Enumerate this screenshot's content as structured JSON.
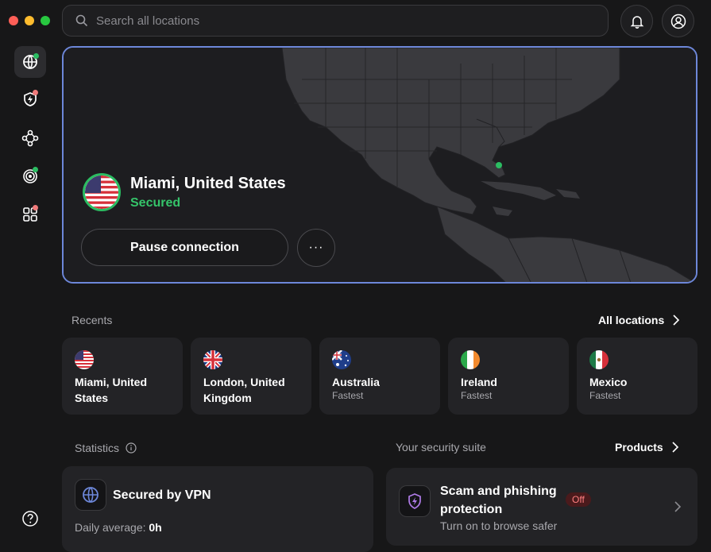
{
  "search": {
    "placeholder": "Search all locations"
  },
  "connection": {
    "location": "Miami, United States",
    "status": "Secured",
    "pause_label": "Pause connection",
    "more_label": "···"
  },
  "recents": {
    "label": "Recents",
    "all_label": "All locations",
    "items": [
      {
        "name": "Miami, United States",
        "sub": "",
        "flag": "us"
      },
      {
        "name": "London, United Kingdom",
        "sub": "",
        "flag": "uk"
      },
      {
        "name": "Australia",
        "sub": "Fastest",
        "flag": "au"
      },
      {
        "name": "Ireland",
        "sub": "Fastest",
        "flag": "ie"
      },
      {
        "name": "Mexico",
        "sub": "Fastest",
        "flag": "mx"
      }
    ]
  },
  "statistics": {
    "label": "Statistics",
    "card_title": "Secured by VPN",
    "daily_label": "Daily average:",
    "daily_value": "0h"
  },
  "security": {
    "label": "Your security suite",
    "products_label": "Products",
    "feature_title": "Scam and phishing protection",
    "feature_status": "Off",
    "feature_sub": "Turn on to browse safer"
  },
  "colors": {
    "accent": "#6d87d9",
    "secured": "#35c46a",
    "dot_green": "#2bbd62",
    "dot_red": "#f07a7a"
  },
  "sidebar": {
    "icons": [
      "globe-icon",
      "shield-bolt-icon",
      "mesh-icon",
      "radar-icon",
      "apps-icon"
    ],
    "help_icon": "help-icon"
  }
}
